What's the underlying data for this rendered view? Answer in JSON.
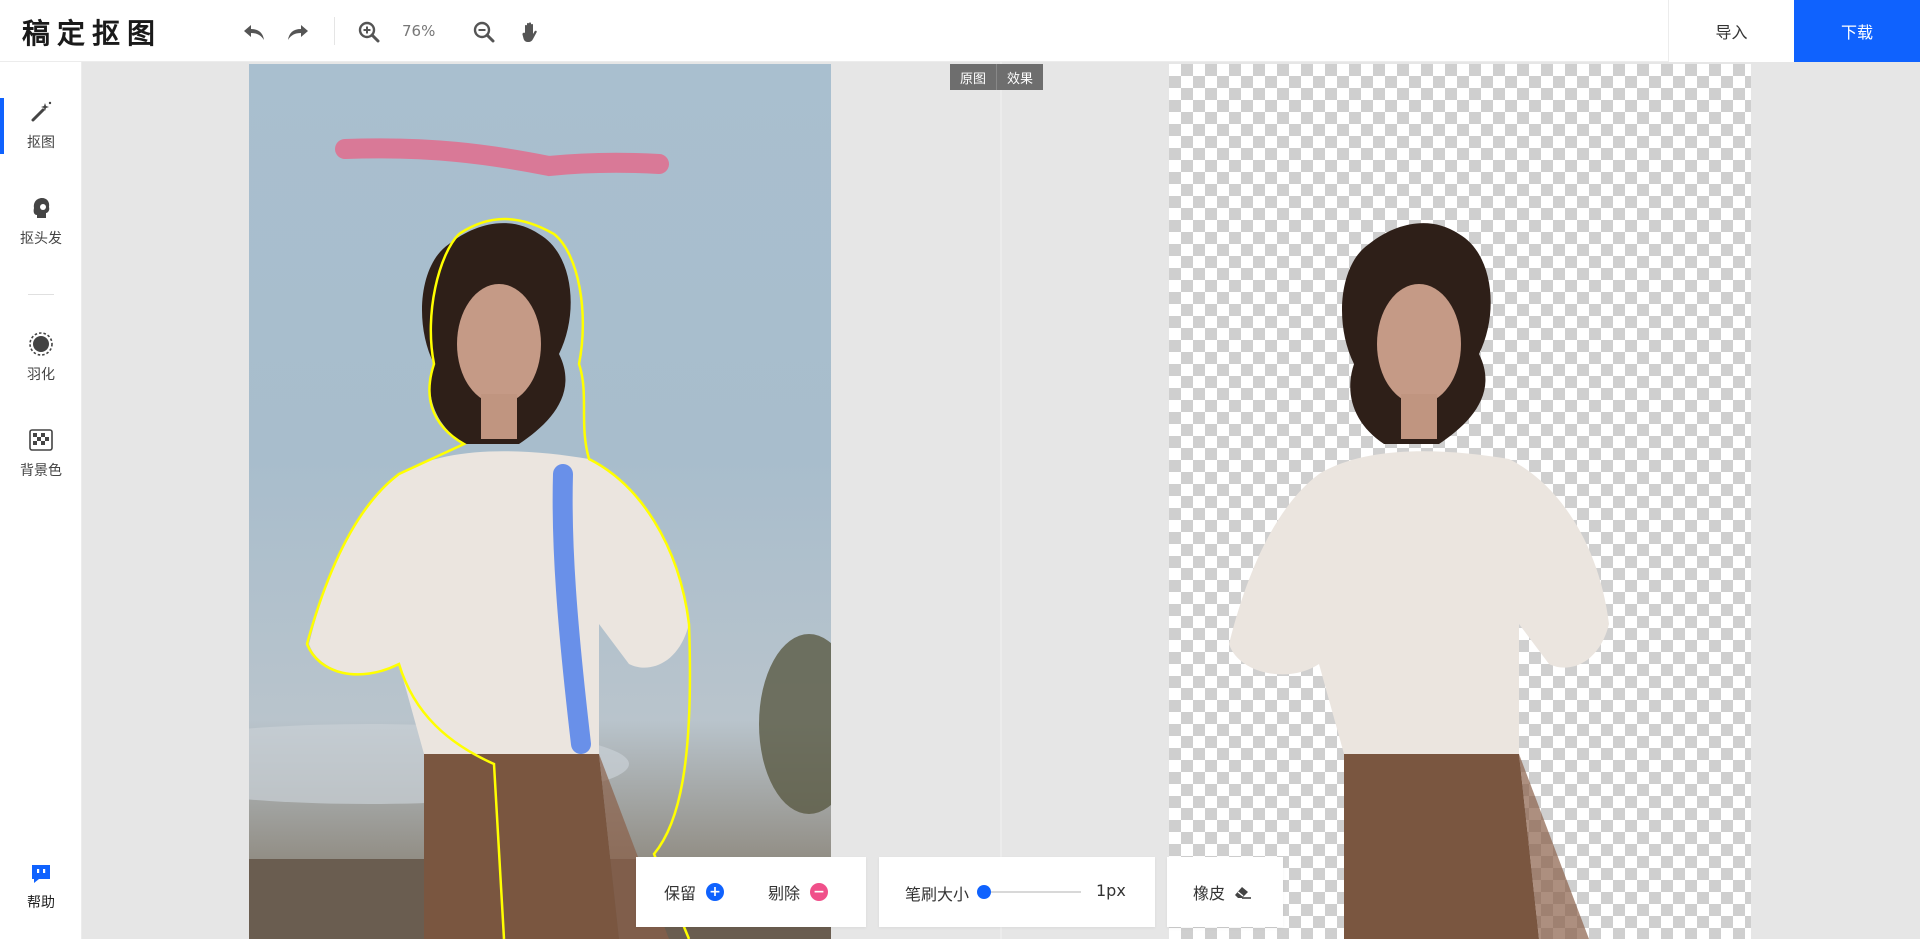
{
  "app": {
    "logo": "稿定抠图"
  },
  "toolbar": {
    "zoom": "76%",
    "import_label": "导入",
    "download_label": "下载"
  },
  "sidebar": {
    "items": [
      {
        "label": "抠图",
        "icon": "magic-wand-icon",
        "active": true
      },
      {
        "label": "抠头发",
        "icon": "hair-head-icon",
        "active": false
      },
      {
        "label": "羽化",
        "icon": "feather-circle-icon",
        "active": false
      },
      {
        "label": "背景色",
        "icon": "checker-background-icon",
        "active": false
      }
    ],
    "help_label": "帮助"
  },
  "view_toggle": {
    "original": "原图",
    "effect": "效果"
  },
  "tools": {
    "keep_label": "保留",
    "remove_label": "剔除",
    "brush_size_label": "笔刷大小",
    "brush_size_value": "1px",
    "brush_size_fraction": 0.0,
    "eraser_label": "橡皮"
  },
  "colors": {
    "accent": "#0f62fe",
    "remove": "#f0508a",
    "outline": "#ffff00",
    "keep_stroke": "#5b86ea",
    "remove_stroke": "#db7593"
  }
}
